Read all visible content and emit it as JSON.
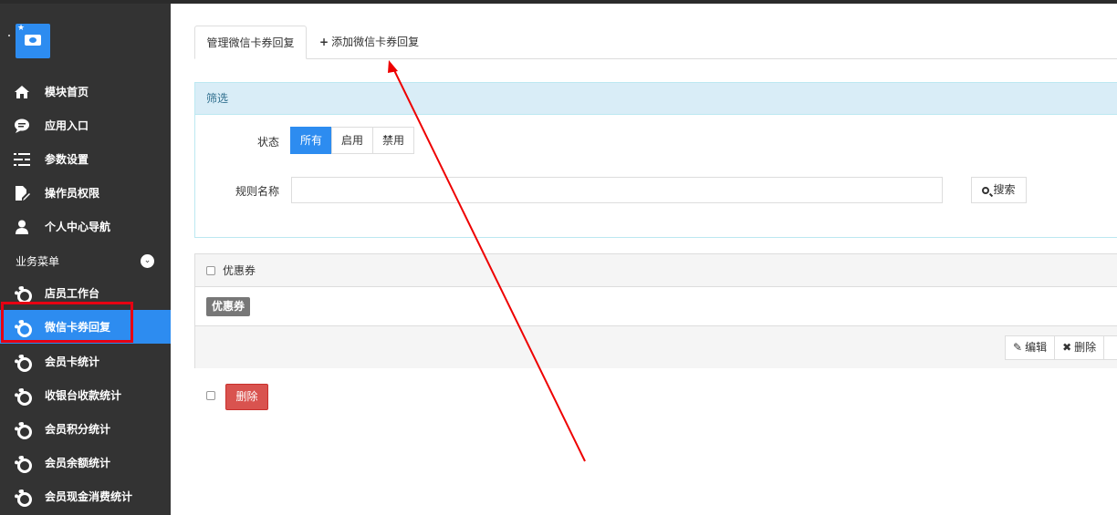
{
  "sidebar": {
    "items": [
      {
        "label": "模块首页",
        "icon": "home-icon"
      },
      {
        "label": "应用入口",
        "icon": "chat-bubble-icon"
      },
      {
        "label": "参数设置",
        "icon": "list-settings-icon"
      },
      {
        "label": "操作员权限",
        "icon": "document-edit-icon"
      },
      {
        "label": "个人中心导航",
        "icon": "user-icon"
      }
    ],
    "section_label": "业务菜单",
    "biz_items": [
      {
        "label": "店员工作台",
        "icon": "gear-icon"
      },
      {
        "label": "微信卡券回复",
        "icon": "gear-icon"
      },
      {
        "label": "会员卡统计",
        "icon": "gear-icon"
      },
      {
        "label": "收银台收款统计",
        "icon": "gear-icon"
      },
      {
        "label": "会员积分统计",
        "icon": "gear-icon"
      },
      {
        "label": "会员余额统计",
        "icon": "gear-icon"
      },
      {
        "label": "会员现金消费统计",
        "icon": "gear-icon"
      }
    ],
    "active_item": "微信卡券回复",
    "accent_color": "#2d8cf0",
    "highlight_color": "#e60012"
  },
  "tabs": {
    "manage_label": "管理微信卡券回复",
    "add_label": "添加微信卡券回复"
  },
  "filter": {
    "title": "筛选",
    "status_label": "状态",
    "status_options": [
      "所有",
      "启用",
      "禁用"
    ],
    "status_selected": "所有",
    "rule_label": "规则名称",
    "rule_value": "",
    "search_label": "搜索"
  },
  "panel": {
    "header": "优惠券",
    "tag": "优惠券",
    "edit_label": "编辑",
    "delete_label": "删除"
  },
  "bottom": {
    "delete_label": "删除"
  }
}
